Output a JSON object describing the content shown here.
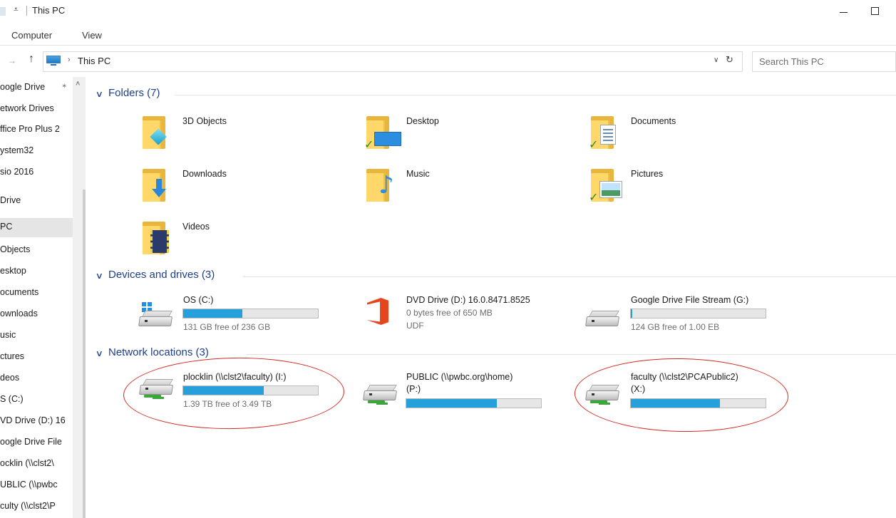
{
  "window": {
    "title": "This PC",
    "qat_arrow": "⩡",
    "minimize_icon": "minimize-icon",
    "maximize_icon": "maximize-icon"
  },
  "ribbon": {
    "tabs": [
      "Computer",
      "View"
    ]
  },
  "address": {
    "path": "This PC",
    "search_placeholder": "Search This PC",
    "up_glyph": "↑",
    "fwd_glyph": "→",
    "chev": "›",
    "dropdown": "∨",
    "refresh": "↻"
  },
  "sidebar": {
    "items": [
      "oogle Drive",
      "etwork Drives",
      "ffice Pro Plus 2",
      "ystem32",
      "sio 2016",
      "Drive",
      "PC",
      "Objects",
      "esktop",
      "ocuments",
      "ownloads",
      "usic",
      "ctures",
      "deos",
      "S (C:)",
      "VD Drive (D:) 16",
      "oogle Drive File",
      "ocklin (\\\\clst2\\",
      "UBLIC (\\\\pwbc",
      "culty (\\\\clst2\\P"
    ],
    "pin_glyph": "📌",
    "scroll_up": "˄"
  },
  "sections": {
    "folders": "Folders (7)",
    "devices": "Devices and drives (3)",
    "network": "Network locations (3)",
    "chevron": "∨"
  },
  "folders": [
    {
      "name": "3D Objects",
      "icon": "3d-objects-folder-icon"
    },
    {
      "name": "Desktop",
      "icon": "desktop-folder-icon"
    },
    {
      "name": "Documents",
      "icon": "documents-folder-icon"
    },
    {
      "name": "Downloads",
      "icon": "downloads-folder-icon"
    },
    {
      "name": "Music",
      "icon": "music-folder-icon"
    },
    {
      "name": "Pictures",
      "icon": "pictures-folder-icon"
    },
    {
      "name": "Videos",
      "icon": "videos-folder-icon"
    }
  ],
  "devices": [
    {
      "name": "OS (C:)",
      "free": "131 GB free of 236 GB",
      "used_fraction": 0.44,
      "icon": "os-drive-icon"
    },
    {
      "name": "DVD Drive (D:) 16.0.8471.8525",
      "free": "0 bytes free of 650 MB",
      "fs": "UDF",
      "icon": "office-dvd-icon"
    },
    {
      "name": "Google Drive File Stream (G:)",
      "free": "124 GB free of 1.00 EB",
      "used_fraction": 0.01,
      "icon": "drive-icon"
    }
  ],
  "network": [
    {
      "name": "plocklin (\\\\clst2\\faculty) (I:)",
      "free": "1.39 TB free of 3.49 TB",
      "used_fraction": 0.6,
      "icon": "network-drive-icon"
    },
    {
      "name": "PUBLIC (\\\\pwbc.org\\home)",
      "name2": "(P:)",
      "used_fraction": 0.67,
      "icon": "network-drive-icon"
    },
    {
      "name": "faculty (\\\\clst2\\PCAPublic2)",
      "name2": "(X:)",
      "used_fraction": 0.66,
      "icon": "network-drive-icon"
    }
  ],
  "colors": {
    "accent": "#26a0da",
    "section": "#1e3f8a",
    "annotation": "#d12a20"
  },
  "check_glyph": "✓"
}
